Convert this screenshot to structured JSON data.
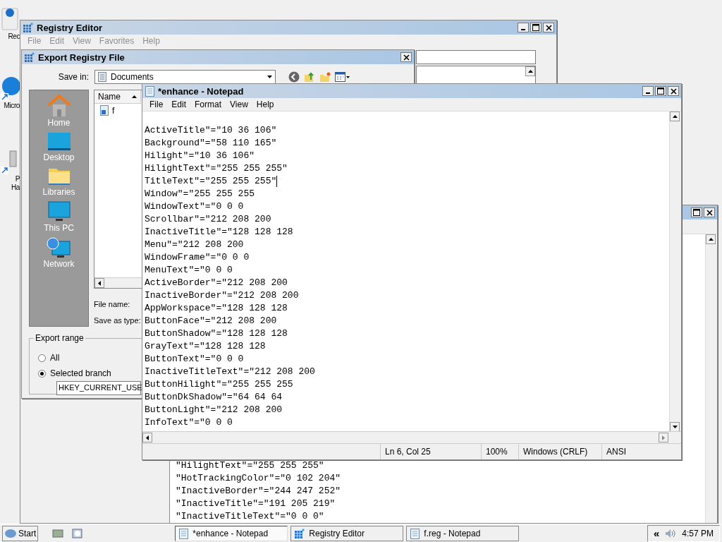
{
  "desktop_icons": [
    {
      "kind": "recycle",
      "label": [
        "Rec"
      ]
    },
    {
      "kind": "browser",
      "label": [
        "Micro"
      ]
    },
    {
      "kind": "tower",
      "label": [
        "P",
        "Ha"
      ]
    }
  ],
  "registry_editor": {
    "title": "Registry Editor",
    "menu": [
      {
        "label": "File",
        "disabled": true
      },
      {
        "label": "Edit",
        "disabled": true
      },
      {
        "label": "View",
        "disabled": true
      },
      {
        "label": "Favorites",
        "disabled": true
      },
      {
        "label": "Help",
        "disabled": true
      }
    ]
  },
  "export_dialog": {
    "title": "Export Registry File",
    "save_in_label": "Save in:",
    "save_in_value": "Documents",
    "places": [
      {
        "kind": "home",
        "label": "Home"
      },
      {
        "kind": "desktop",
        "label": "Desktop"
      },
      {
        "kind": "libraries",
        "label": "Libraries"
      },
      {
        "kind": "pc",
        "label": "This PC"
      },
      {
        "kind": "network",
        "label": "Network"
      }
    ],
    "file_list": {
      "column": "Name",
      "items": [
        {
          "name": "f"
        }
      ]
    },
    "file_name_label": "File name:",
    "save_as_type_label": "Save as type:",
    "export_range": {
      "title": "Export range",
      "options": [
        {
          "label": "All",
          "selected": false
        },
        {
          "label": "Selected branch",
          "selected": true
        }
      ],
      "branch_value": "HKEY_CURRENT_USE"
    }
  },
  "notepad": {
    "title": "*enhance - Notepad",
    "menu": [
      "File",
      "Edit",
      "Format",
      "View",
      "Help"
    ],
    "lines": [
      {
        "text": "ActiveTitle\"=\"10 36 106\"",
        "caret": false
      },
      {
        "text": "Background\"=\"58 110 165\"",
        "caret": false
      },
      {
        "text": "Hilight\"=\"10 36 106\"",
        "caret": false
      },
      {
        "text": "HilightText\"=\"255 255 255\"",
        "caret": false
      },
      {
        "text": "TitleText\"=\"255 255 255\"",
        "caret": true
      },
      {
        "text": "Window\"=\"255 255 255",
        "caret": false
      },
      {
        "text": "WindowText\"=\"0 0 0",
        "caret": false
      },
      {
        "text": "Scrollbar\"=\"212 208 200",
        "caret": false
      },
      {
        "text": "InactiveTitle\"=\"128 128 128",
        "caret": false
      },
      {
        "text": "Menu\"=\"212 208 200",
        "caret": false
      },
      {
        "text": "WindowFrame\"=\"0 0 0",
        "caret": false
      },
      {
        "text": "MenuText\"=\"0 0 0",
        "caret": false
      },
      {
        "text": "ActiveBorder\"=\"212 208 200",
        "caret": false
      },
      {
        "text": "InactiveBorder\"=\"212 208 200",
        "caret": false
      },
      {
        "text": "AppWorkspace\"=\"128 128 128",
        "caret": false
      },
      {
        "text": "ButtonFace\"=\"212 208 200",
        "caret": false
      },
      {
        "text": "ButtonShadow\"=\"128 128 128",
        "caret": false
      },
      {
        "text": "GrayText\"=\"128 128 128",
        "caret": false
      },
      {
        "text": "ButtonText\"=\"0 0 0",
        "caret": false
      },
      {
        "text": "InactiveTitleText\"=\"212 208 200",
        "caret": false
      },
      {
        "text": "ButtonHilight\"=\"255 255 255",
        "caret": false
      },
      {
        "text": "ButtonDkShadow\"=\"64 64 64",
        "caret": false
      },
      {
        "text": "ButtonLight\"=\"212 208 200",
        "caret": false
      },
      {
        "text": "InfoText\"=\"0 0 0",
        "caret": false
      }
    ],
    "status": [
      "Ln 6, Col 25",
      "100%",
      "Windows (CRLF)",
      "ANSI"
    ]
  },
  "notepad_behind": {
    "lines": [
      "\"HilightText\"=\"255 255 255\"",
      "\"HotTrackingColor\"=\"0 102 204\"",
      "\"InactiveBorder\"=\"244 247 252\"",
      "\"InactiveTitle\"=\"191 205 219\"",
      "\"InactiveTitleText\"=\"0 0 0\""
    ]
  },
  "taskbar": {
    "start": "Start",
    "tasks": [
      {
        "kind": "notepad",
        "label": "*enhance - Notepad",
        "selected": true
      },
      {
        "kind": "registry",
        "label": "Registry Editor",
        "selected": false
      },
      {
        "kind": "notepad",
        "label": "f.reg - Notepad",
        "selected": false
      }
    ],
    "chevron": "«",
    "clock": "4:57 PM"
  }
}
